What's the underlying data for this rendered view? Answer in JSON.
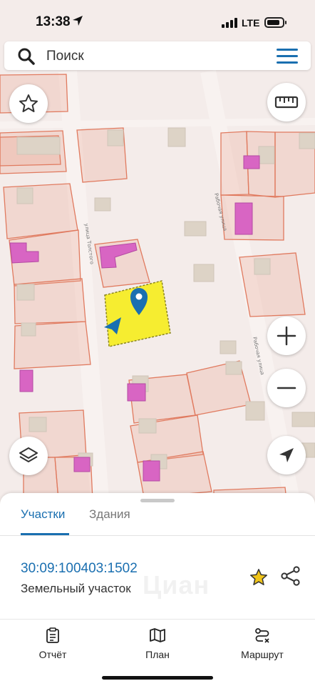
{
  "status_bar": {
    "time": "13:38",
    "network": "LTE"
  },
  "search": {
    "placeholder": "Поиск"
  },
  "map": {
    "street_labels": [
      "улица Толстого",
      "Рабочая улица",
      "Рабочая улица"
    ],
    "selected_parcel_color": "#f5ed1f",
    "parcel_outline_color": "#e07a5f",
    "building_color": "#d865c3"
  },
  "map_controls": [
    "star-icon",
    "ruler-icon",
    "zoom-in-icon",
    "zoom-out-icon",
    "layers-icon",
    "location-arrow-icon"
  ],
  "panel": {
    "tabs": [
      {
        "label": "Участки",
        "active": true
      },
      {
        "label": "Здания",
        "active": false
      }
    ],
    "parcel": {
      "cadastral_number": "30:09:100403:1502",
      "type": "Земельный участок"
    },
    "watermark": "Циан"
  },
  "bottom_nav": [
    {
      "label": "Отчёт",
      "icon": "clipboard-icon"
    },
    {
      "label": "План",
      "icon": "map-icon"
    },
    {
      "label": "Маршрут",
      "icon": "route-icon"
    }
  ],
  "colors": {
    "accent": "#1a6fb0",
    "star": "#f0c419"
  }
}
